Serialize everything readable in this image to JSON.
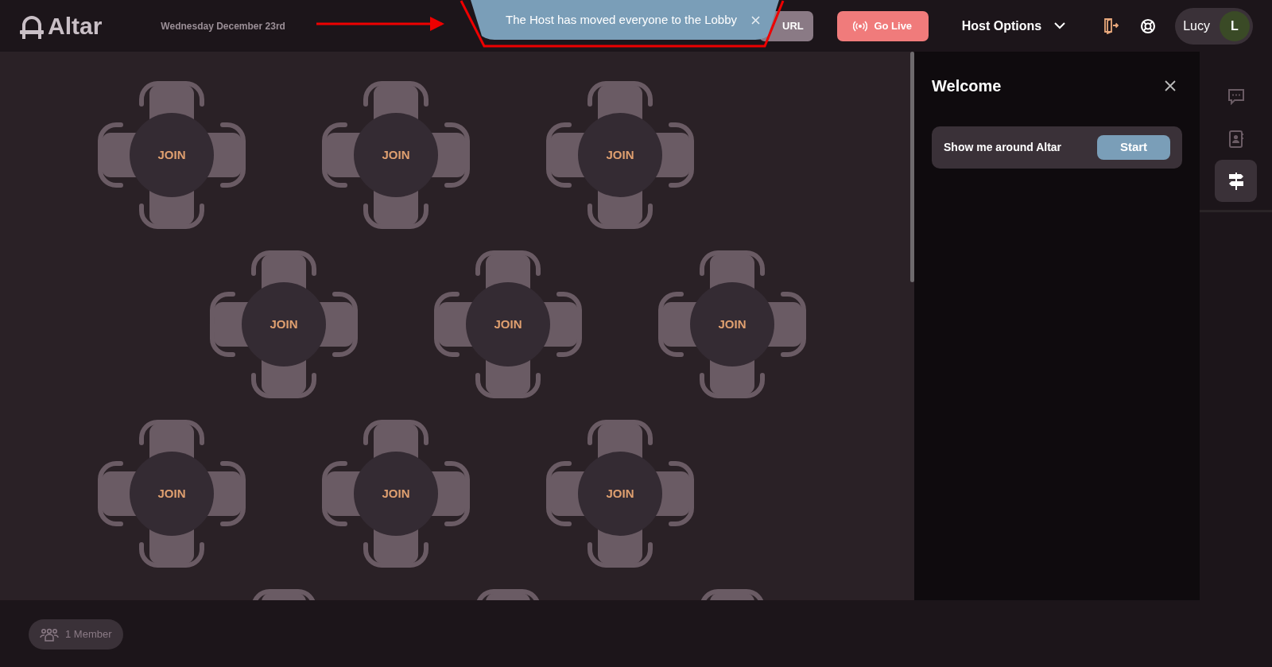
{
  "header": {
    "logo": "Altar",
    "date": "Wednesday December 23rd",
    "url_button": "URL",
    "go_live": "Go Live",
    "host_options": "Host Options",
    "user": {
      "name": "Lucy",
      "initial": "L"
    }
  },
  "toast": {
    "message": "The Host has moved everyone to the Lobby"
  },
  "tables": [
    {
      "kind": "full",
      "label": "JOIN"
    },
    {
      "kind": "full",
      "label": "JOIN"
    },
    {
      "kind": "full",
      "label": "JOIN"
    },
    {
      "kind": "full",
      "label": "JOIN"
    },
    {
      "kind": "full",
      "label": "JOIN"
    },
    {
      "kind": "full",
      "label": "JOIN"
    },
    {
      "kind": "full",
      "label": "JOIN"
    },
    {
      "kind": "full",
      "label": "JOIN"
    },
    {
      "kind": "full",
      "label": "JOIN"
    },
    {
      "kind": "cut"
    },
    {
      "kind": "cut"
    },
    {
      "kind": "cut"
    }
  ],
  "panel": {
    "title": "Welcome",
    "tour": {
      "label": "Show me around Altar",
      "button": "Start"
    }
  },
  "side_tabs": [
    {
      "kind": "chat",
      "selected": false
    },
    {
      "kind": "contacts",
      "selected": false
    },
    {
      "kind": "guide",
      "selected": true
    }
  ],
  "footer": {
    "members": "1 Member"
  }
}
